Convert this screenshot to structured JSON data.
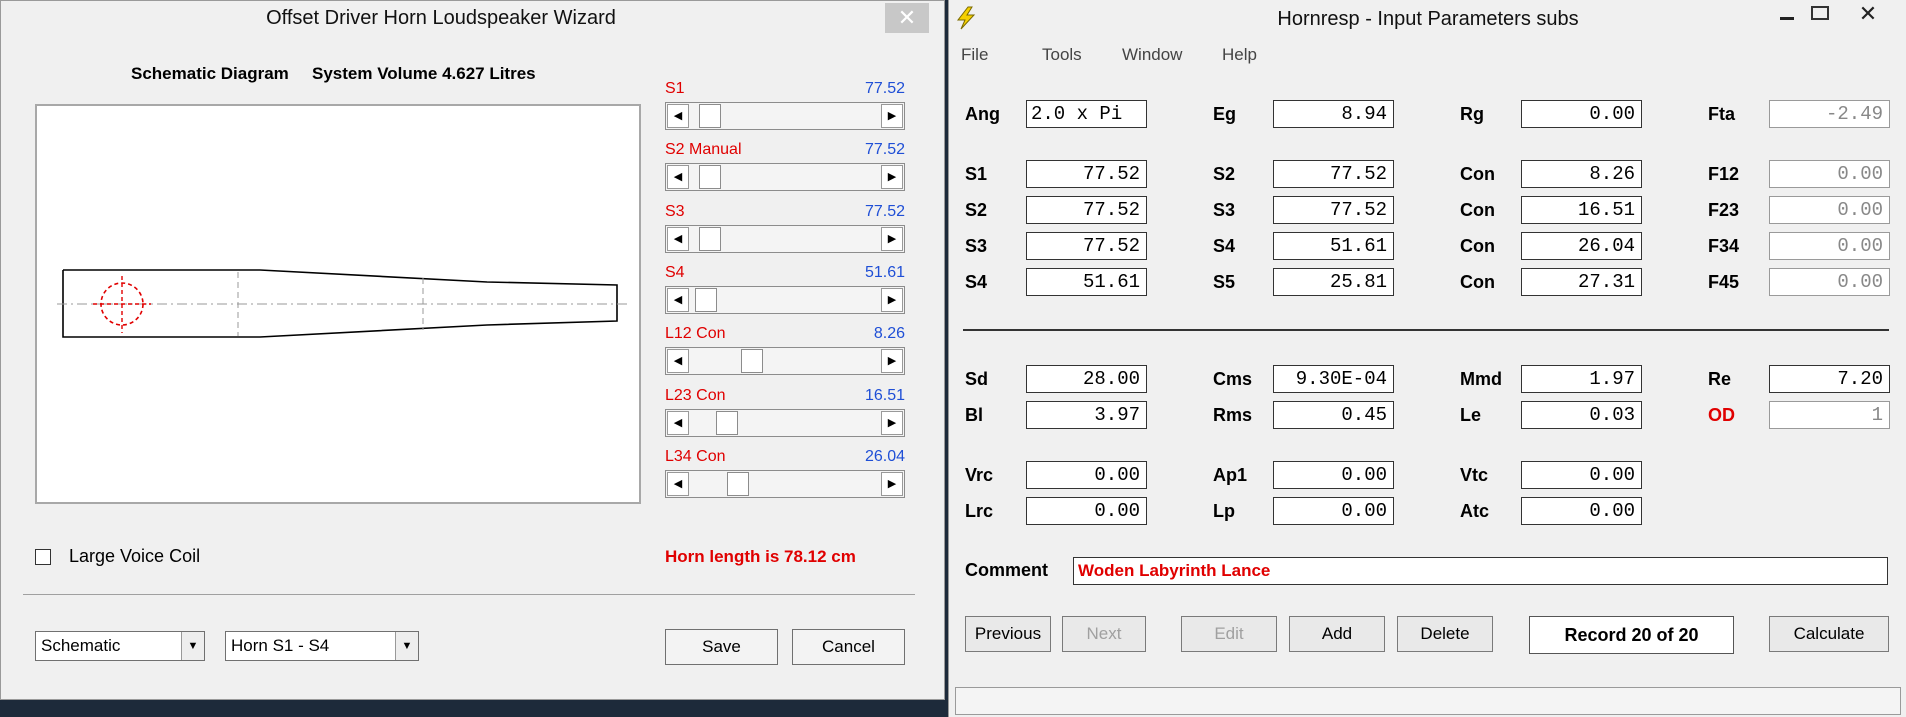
{
  "wizard": {
    "title": "Offset Driver Horn Loudspeaker Wizard",
    "close_glyph": "✕",
    "schematic_header": "Schematic Diagram",
    "system_volume": "System Volume 4.627 Litres",
    "sliders": [
      {
        "label": "S1",
        "value": "77.52",
        "fraction": 0.05
      },
      {
        "label": "S2 Manual",
        "value": "77.52",
        "fraction": 0.05
      },
      {
        "label": "S3",
        "value": "77.52",
        "fraction": 0.05
      },
      {
        "label": "S4",
        "value": "51.61",
        "fraction": 0.03
      },
      {
        "label": "L12 Con",
        "value": "8.26",
        "fraction": 0.3
      },
      {
        "label": "L23 Con",
        "value": "16.51",
        "fraction": 0.15
      },
      {
        "label": "L34 Con",
        "value": "26.04",
        "fraction": 0.22
      }
    ],
    "large_voice_coil_label": "Large Voice Coil",
    "large_voice_coil_checked": false,
    "horn_length": "Horn length is 78.12 cm",
    "view_select": "Schematic",
    "horn_select": "Horn S1 - S4",
    "save_label": "Save",
    "cancel_label": "Cancel"
  },
  "hornresp": {
    "title": "Hornresp - Input Parameters   subs",
    "icon": "lightning-icon",
    "menu": [
      "File",
      "Tools",
      "Window",
      "Help"
    ],
    "rows_top": [
      [
        {
          "l": "Ang",
          "v": "2.0 x Pi",
          "align": "left"
        },
        {
          "l": "Eg",
          "v": "8.94"
        },
        {
          "l": "Rg",
          "v": "0.00"
        },
        {
          "l": "Fta",
          "v": "-2.49",
          "ro": true
        }
      ]
    ],
    "rows_seg": [
      [
        {
          "l": "S1",
          "v": "77.52"
        },
        {
          "l": "S2",
          "v": "77.52"
        },
        {
          "l": "Con",
          "v": "8.26"
        },
        {
          "l": "F12",
          "v": "0.00",
          "ro": true
        }
      ],
      [
        {
          "l": "S2",
          "v": "77.52"
        },
        {
          "l": "S3",
          "v": "77.52"
        },
        {
          "l": "Con",
          "v": "16.51"
        },
        {
          "l": "F23",
          "v": "0.00",
          "ro": true
        }
      ],
      [
        {
          "l": "S3",
          "v": "77.52"
        },
        {
          "l": "S4",
          "v": "51.61"
        },
        {
          "l": "Con",
          "v": "26.04"
        },
        {
          "l": "F34",
          "v": "0.00",
          "ro": true
        }
      ],
      [
        {
          "l": "S4",
          "v": "51.61"
        },
        {
          "l": "S5",
          "v": "25.81"
        },
        {
          "l": "Con",
          "v": "27.31"
        },
        {
          "l": "F45",
          "v": "0.00",
          "ro": true
        }
      ]
    ],
    "rows_driver": [
      [
        {
          "l": "Sd",
          "v": "28.00"
        },
        {
          "l": "Cms",
          "v": "9.30E-04"
        },
        {
          "l": "Mmd",
          "v": "1.97"
        },
        {
          "l": "Re",
          "v": "7.20"
        }
      ],
      [
        {
          "l": "Bl",
          "v": "3.97"
        },
        {
          "l": "Rms",
          "v": "0.45"
        },
        {
          "l": "Le",
          "v": "0.03"
        },
        {
          "l": "OD",
          "v": "1",
          "ro": true,
          "red": true
        }
      ]
    ],
    "rows_chamber": [
      [
        {
          "l": "Vrc",
          "v": "0.00"
        },
        {
          "l": "Ap1",
          "v": "0.00"
        },
        {
          "l": "Vtc",
          "v": "0.00"
        }
      ],
      [
        {
          "l": "Lrc",
          "v": "0.00"
        },
        {
          "l": "Lp",
          "v": "0.00"
        },
        {
          "l": "Atc",
          "v": "0.00"
        }
      ]
    ],
    "comment_label": "Comment",
    "comment_value": "Woden Labyrinth Lance",
    "buttons": {
      "previous": "Previous",
      "next": "Next",
      "edit": "Edit",
      "add": "Add",
      "delete": "Delete",
      "calculate": "Calculate"
    },
    "record": "Record 20 of 20",
    "colors": {
      "red": "#e00000",
      "blue": "#1f4fd6",
      "bg": "#f0f0f0"
    }
  }
}
